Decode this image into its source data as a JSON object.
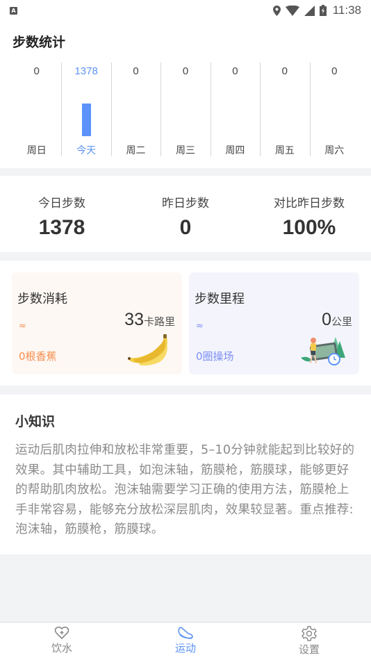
{
  "status_bar": {
    "left_icon": "a-notification-icon",
    "time": "11:38",
    "icons": [
      "location-icon",
      "wifi-icon",
      "signal-icon",
      "battery-charging-icon"
    ]
  },
  "steps_section": {
    "title": "步数统计"
  },
  "chart_data": {
    "type": "bar",
    "title": "步数统计",
    "categories": [
      "周日",
      "今天",
      "周二",
      "周三",
      "周四",
      "周五",
      "周六"
    ],
    "values": [
      0,
      1378,
      0,
      0,
      0,
      0,
      0
    ],
    "highlight_index": 1,
    "highlight_color": "#5b93fb",
    "xlabel": "",
    "ylabel": "",
    "grid": false
  },
  "summary": {
    "items": [
      {
        "label": "今日步数",
        "value": "1378"
      },
      {
        "label": "昨日步数",
        "value": "0"
      },
      {
        "label": "对比昨日步数",
        "value": "100%"
      }
    ]
  },
  "cards": {
    "calories": {
      "title": "步数消耗",
      "approx": "≈",
      "value": "33",
      "unit": "卡路里",
      "equivalent": "0根香蕉",
      "illustration": "banana-icon",
      "accent": "#f88d4c"
    },
    "distance": {
      "title": "步数里程",
      "approx": "≈",
      "value": "0",
      "unit": "公里",
      "equivalent": "0圈操场",
      "illustration": "runner-track-icon",
      "accent": "#7b8ef5"
    }
  },
  "tips": {
    "title": "小知识",
    "body": "运动后肌肉拉伸和放松非常重要，5–10分钟就能起到比较好的效果。其中辅助工具，如泡沫轴，筋膜枪，筋膜球，能够更好的帮助肌肉放松。泡沫轴需要学习正确的使用方法，筋膜枪上手非常容易，能够充分放松深层肌肉，效果较显著。重点推荐:泡沫轴，筋膜枪，筋膜球。"
  },
  "tabbar": {
    "active_color": "#5b93f5",
    "tabs": [
      {
        "label": "饮水",
        "icon": "heart-plus-icon",
        "active": false
      },
      {
        "label": "运动",
        "icon": "sneaker-icon",
        "active": true
      },
      {
        "label": "设置",
        "icon": "gear-icon",
        "active": false
      }
    ]
  }
}
